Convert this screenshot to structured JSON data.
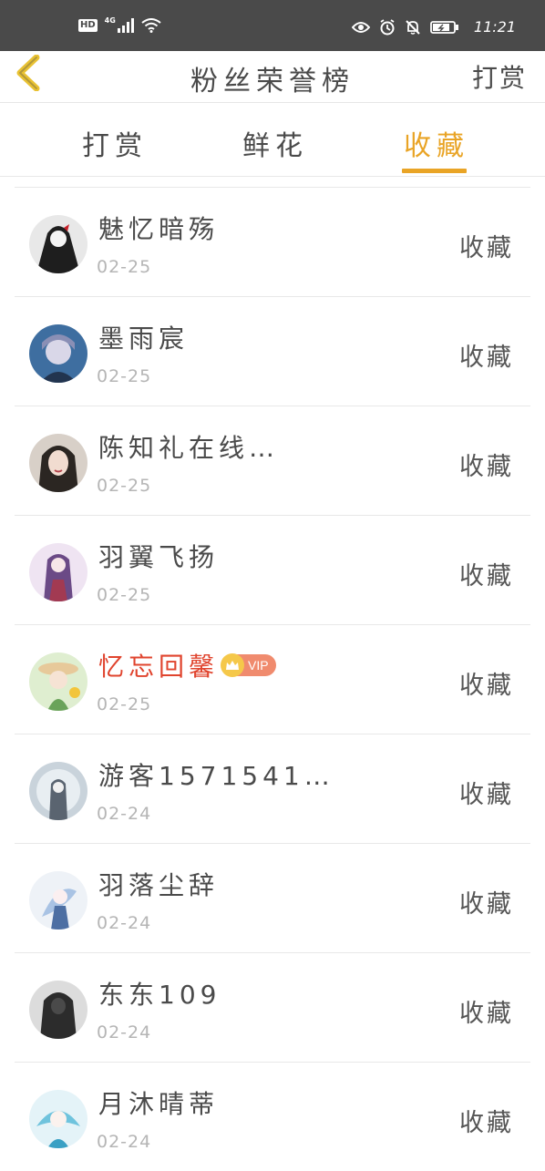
{
  "status_bar": {
    "hd": "HD",
    "network": "4G",
    "time": "11:21"
  },
  "nav": {
    "title": "粉丝荣誉榜",
    "action": "打赏"
  },
  "tabs": [
    {
      "label": "打赏",
      "active": false
    },
    {
      "label": "鲜花",
      "active": false
    },
    {
      "label": "收藏",
      "active": true
    }
  ],
  "accent_color": "#e9a426",
  "vip_name_color": "#e0442e",
  "list": [
    {
      "name": "魅忆暗殇",
      "date": "02-25",
      "action": "收藏",
      "vip": false,
      "vip_label": ""
    },
    {
      "name": "墨雨宸",
      "date": "02-25",
      "action": "收藏",
      "vip": false,
      "vip_label": ""
    },
    {
      "name": "陈知礼在线…",
      "date": "02-25",
      "action": "收藏",
      "vip": false,
      "vip_label": ""
    },
    {
      "name": "羽翼飞扬",
      "date": "02-25",
      "action": "收藏",
      "vip": false,
      "vip_label": ""
    },
    {
      "name": "忆忘回馨",
      "date": "02-25",
      "action": "收藏",
      "vip": true,
      "vip_label": "VIP"
    },
    {
      "name": "游客1571541…",
      "date": "02-24",
      "action": "收藏",
      "vip": false,
      "vip_label": ""
    },
    {
      "name": "羽落尘辞",
      "date": "02-24",
      "action": "收藏",
      "vip": false,
      "vip_label": ""
    },
    {
      "name": "东东109",
      "date": "02-24",
      "action": "收藏",
      "vip": false,
      "vip_label": ""
    },
    {
      "name": "月沐晴蒂",
      "date": "02-24",
      "action": "收藏",
      "vip": false,
      "vip_label": ""
    }
  ]
}
